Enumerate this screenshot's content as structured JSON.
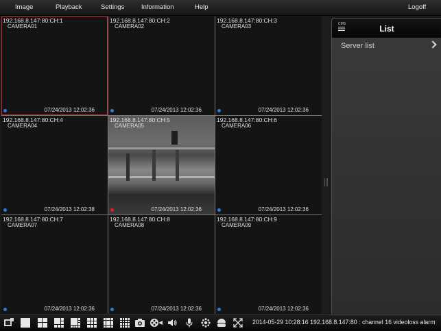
{
  "menu": {
    "image": "Image",
    "playback": "Playback",
    "settings": "Settings",
    "information": "Information",
    "help": "Help",
    "logoff": "Logoff"
  },
  "cameras": [
    {
      "addr": "192.168.8.147:80:CH:1",
      "name": "CAMERA01",
      "ts": "07/24/2013 12:02:36"
    },
    {
      "addr": "192.168.8.147:80:CH:2",
      "name": "CAMERA02",
      "ts": "07/24/2013 12:02:36"
    },
    {
      "addr": "192.168.8.147:80:CH:3",
      "name": "CAMERA03",
      "ts": "07/24/2013 12:02:36"
    },
    {
      "addr": "192.168.8.147:80:CH:4",
      "name": "CAMERA04",
      "ts": "07/24/2013 12:02:38"
    },
    {
      "addr": "192.168.8.147:80:CH:5",
      "name": "CAMERA05",
      "ts": "07/24/2013 12:02:36"
    },
    {
      "addr": "192.168.8.147:80:CH:6",
      "name": "CAMERA06",
      "ts": "07/24/2013 12:02:36"
    },
    {
      "addr": "192.168.8.147:80:CH:7",
      "name": "CAMERA07",
      "ts": "07/24/2013 12:02:36"
    },
    {
      "addr": "192.168.8.147:80:CH:8",
      "name": "CAMERA08",
      "ts": "07/24/2013 12:02:36"
    },
    {
      "addr": "192.168.8.147:80:CH:9",
      "name": "CAMERA09",
      "ts": "07/24/2013 12:02:36"
    }
  ],
  "panel": {
    "logo_text": "CMS",
    "title": "List",
    "server_list": "Server list"
  },
  "toolbar": {
    "status": "2014-05-29 10:28:16 192.168.8.147:80 : channel 16 videoloss alarm",
    "icons": [
      "channel-list-icon",
      "layout-1-icon",
      "layout-4-icon",
      "layout-6-icon",
      "layout-8-icon",
      "layout-9-icon",
      "layout-13-icon",
      "layout-16-icon",
      "snapshot-icon",
      "record-icon",
      "speaker-icon",
      "microphone-icon",
      "color-settings-icon",
      "ptz-icon",
      "fullscreen-icon"
    ]
  },
  "colors": {
    "active_border": "#c0282d",
    "status_dot": "#2f7bdc",
    "record_dot": "#dd2222"
  }
}
